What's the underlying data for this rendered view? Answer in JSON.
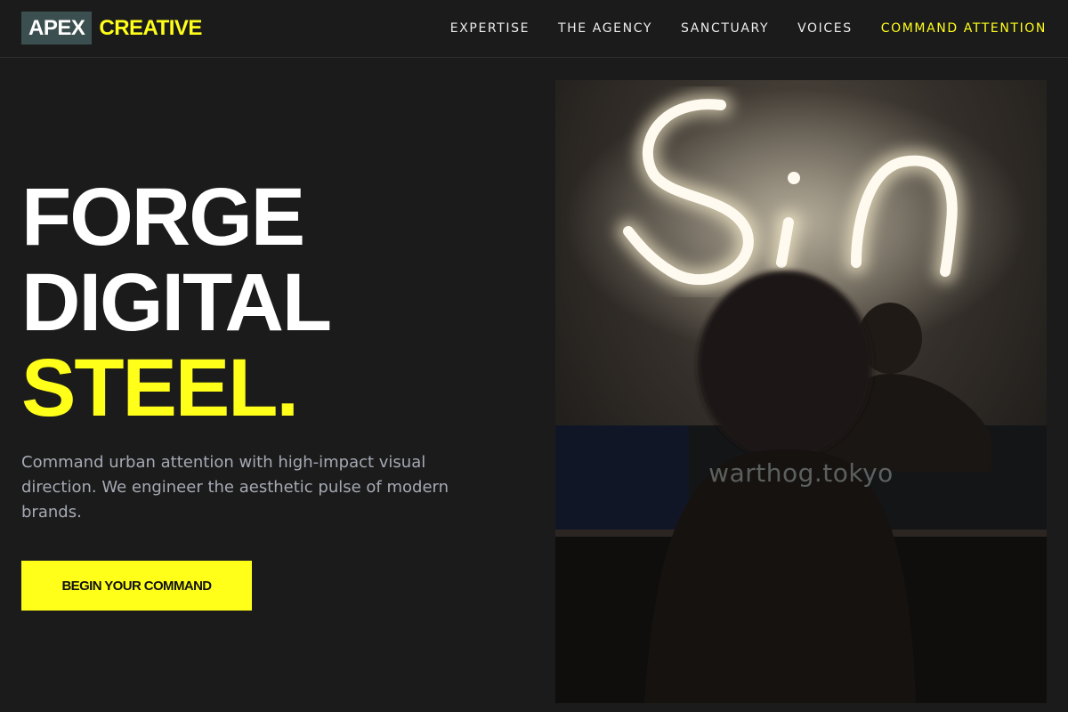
{
  "brand": {
    "box_text": "APEX",
    "word_text": "CREATIVE",
    "box_color": "#3c4f50",
    "accent_color": "#ffff1a"
  },
  "nav": {
    "items": [
      {
        "label": "EXPERTISE"
      },
      {
        "label": "THE AGENCY"
      },
      {
        "label": "SANCTUARY"
      },
      {
        "label": "VOICES"
      },
      {
        "label": "COMMAND ATTENTION"
      }
    ]
  },
  "hero": {
    "title_lines": [
      "FORGE",
      "DIGITAL",
      "STEEL."
    ],
    "subtitle": "Command urban attention with high-impact visual direction. We engineer the aesthetic pulse of modern brands.",
    "cta_label": "BEGIN YOUR COMMAND"
  },
  "image": {
    "caption": "warthog.tokyo",
    "sign_text": "Sin",
    "description_icon": "neon-sign-photo"
  },
  "colors": {
    "background": "#1b1b1b",
    "text": "#ffffff",
    "muted_text": "#a5a9b3",
    "accent": "#ffff1a"
  }
}
